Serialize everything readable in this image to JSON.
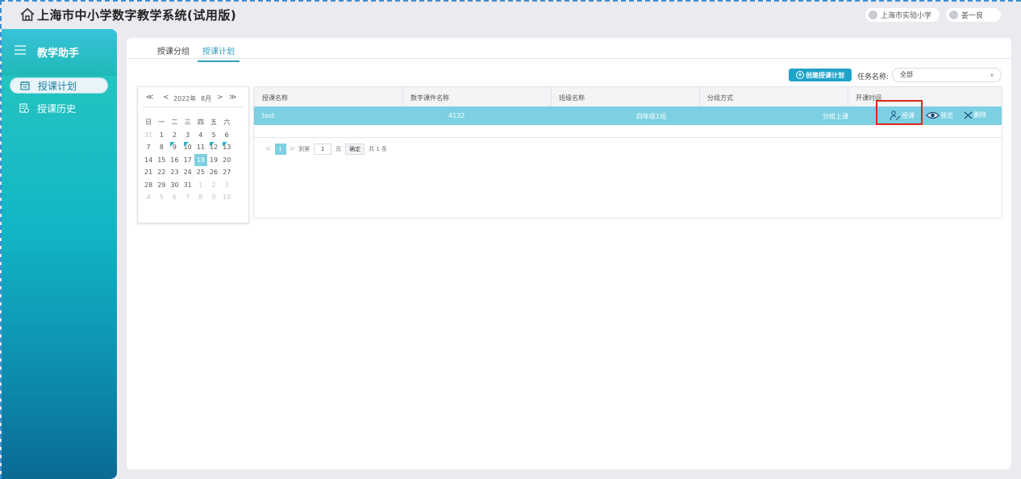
{
  "app": {
    "title": "上海市中小学数字教学系统(试用版)"
  },
  "header": {
    "school": "上海市实验小学",
    "user": "姜一良"
  },
  "sidebar": {
    "title": "教学助手",
    "items": [
      {
        "label": "授课计划",
        "active": true
      },
      {
        "label": "授课历史",
        "active": false
      }
    ]
  },
  "tabs": [
    {
      "label": "授课分组",
      "active": false
    },
    {
      "label": "授课计划",
      "active": true
    }
  ],
  "toolbar": {
    "create_label": "创建授课计划",
    "task_label": "任务名称:",
    "task_value": "全部"
  },
  "calendar": {
    "year_label": "2022年",
    "month_label": "8月",
    "prev_year": "≪",
    "prev_month": "<",
    "next_month": ">",
    "next_year": "≫",
    "weekdays": [
      "日",
      "一",
      "二",
      "三",
      "四",
      "五",
      "六"
    ],
    "weeks": [
      [
        "31",
        "1",
        "2",
        "3",
        "4",
        "5",
        "6"
      ],
      [
        "7",
        "8",
        "9",
        "10",
        "11",
        "12",
        "13"
      ],
      [
        "14",
        "15",
        "16",
        "17",
        "18",
        "19",
        "20"
      ],
      [
        "21",
        "22",
        "23",
        "24",
        "25",
        "26",
        "27"
      ],
      [
        "28",
        "29",
        "30",
        "31",
        "1",
        "2",
        "3"
      ],
      [
        "4",
        "5",
        "6",
        "7",
        "8",
        "9",
        "10"
      ]
    ],
    "selected": "18"
  },
  "table": {
    "columns": [
      "授课名称",
      "数字课件名称",
      "班级名称",
      "分组方式",
      "开课时间"
    ],
    "rows": [
      {
        "name": "test",
        "courseware": "4132",
        "class": "四年级1班",
        "group": "分组上课",
        "actions": {
          "teach": "授课",
          "preview": "预览",
          "delete": "删除"
        }
      }
    ]
  },
  "pager": {
    "prev": "<",
    "current": "1",
    "next": ">",
    "goto_label": "到第",
    "page_input": "1",
    "page_unit": "页",
    "confirm": "确定",
    "total": "共 1 条"
  },
  "colors": {
    "accent": "#1fa3c9",
    "row_selected": "#7cd0e2",
    "highlight": "#e2251b"
  }
}
